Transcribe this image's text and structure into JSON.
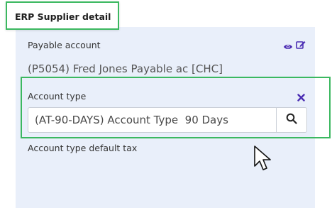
{
  "section": {
    "title": "ERP Supplier detail"
  },
  "payable": {
    "label": "Payable account",
    "value": "(P5054) Fred Jones Payable ac [CHC]",
    "view_icon": "eye-icon",
    "edit_icon": "edit-icon"
  },
  "account_type": {
    "label": "Account type",
    "value": "(AT-90-DAYS) Account Type  90 Days",
    "clear_icon": "close-icon",
    "search_icon": "search-icon"
  },
  "default_tax": {
    "label": "Account type default tax"
  },
  "colors": {
    "panel_bg": "#e9effa",
    "highlight": "#3bb860",
    "icon_accent": "#4b2db3"
  }
}
